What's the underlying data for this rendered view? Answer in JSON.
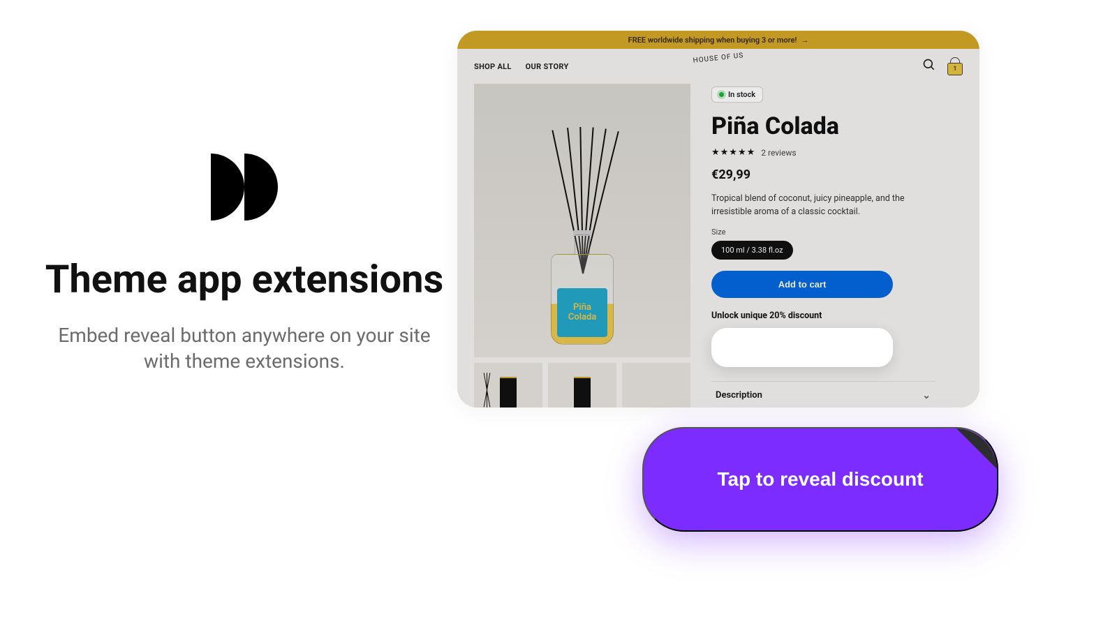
{
  "promo": {
    "title": "Theme app extensions",
    "subtitle": "Embed reveal button anywhere on your site with theme extensions."
  },
  "store": {
    "announcement": "FREE worldwide shipping when buying 3 or more!",
    "nav": {
      "shop_all": "SHOP ALL",
      "our_story": "OUR STORY"
    },
    "brand": "HOUSE OF US",
    "cart_count": "1",
    "product": {
      "stock_label": "In stock",
      "title": "Piña Colada",
      "reviews_text": "2 reviews",
      "rating_stars": 5,
      "price": "€29,99",
      "description": "Tropical blend of coconut, juicy pineapple, and the irresistible aroma of a classic cocktail.",
      "option_label": "Size",
      "option_value": "100 ml / 3.38 fl.oz",
      "add_to_cart": "Add to cart",
      "unlock_label": "Unlock unique 20% discount",
      "accordion_title": "Description",
      "label_line1": "Piña",
      "label_line2": "Colada"
    }
  },
  "cta": {
    "label": "Tap to reveal discount"
  }
}
